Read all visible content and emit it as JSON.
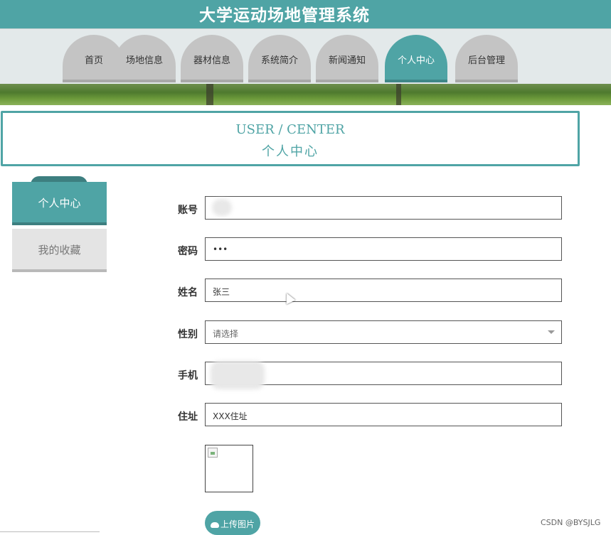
{
  "app_title": "大学运动场地管理系统",
  "nav": {
    "tabs": [
      {
        "label": "首页"
      },
      {
        "label": "场地信息"
      },
      {
        "label": "器材信息"
      },
      {
        "label": "系统简介"
      },
      {
        "label": "新闻通知"
      },
      {
        "label": "个人中心",
        "active": true
      },
      {
        "label": "后台管理"
      }
    ]
  },
  "section_header": {
    "english": "USER / CENTER",
    "chinese": "个人中心"
  },
  "sidebar": {
    "items": [
      {
        "label": "个人中心",
        "active": true
      },
      {
        "label": "我的收藏"
      }
    ]
  },
  "form": {
    "account": {
      "label": "账号",
      "value": ""
    },
    "password": {
      "label": "密码",
      "value": "•••"
    },
    "name": {
      "label": "姓名",
      "value": "张三"
    },
    "gender": {
      "label": "性别",
      "placeholder": "请选择"
    },
    "phone": {
      "label": "手机",
      "value": ""
    },
    "address": {
      "label": "住址",
      "value": "XXX住址"
    }
  },
  "upload_button": {
    "label": "上传图片",
    "icon": "cloud-upload-icon"
  },
  "watermark": "CSDN @BYSJLG",
  "colors": {
    "accent": "#4fa4a5",
    "accent_dark": "#3d7f80",
    "tab_gray": "#c4c4c4"
  }
}
